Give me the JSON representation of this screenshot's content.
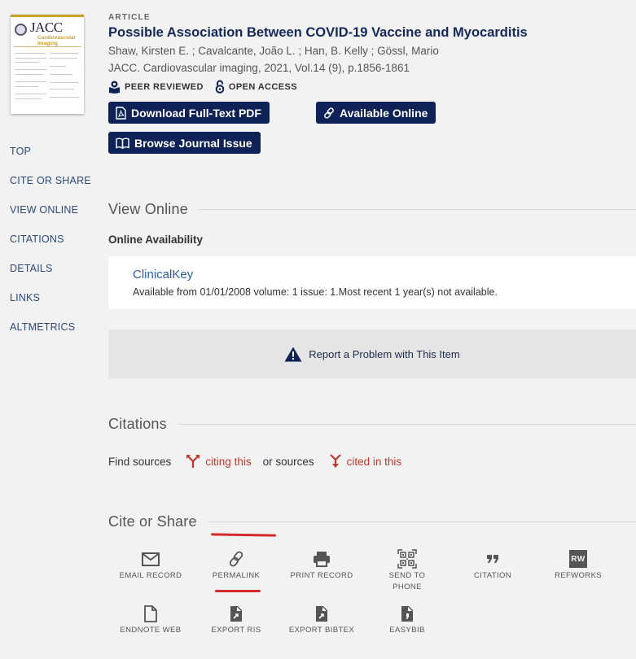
{
  "thumbnail": {
    "journal": "JACC",
    "subtitle_line1": "Cardiovascular",
    "subtitle_line2": "Imaging"
  },
  "sidebar": {
    "items": [
      {
        "label": "TOP"
      },
      {
        "label": "CITE OR SHARE"
      },
      {
        "label": "VIEW ONLINE"
      },
      {
        "label": "CITATIONS"
      },
      {
        "label": "DETAILS"
      },
      {
        "label": "LINKS"
      },
      {
        "label": "ALTMETRICS"
      }
    ]
  },
  "record": {
    "type": "ARTICLE",
    "title": "Possible Association Between COVID-19 Vaccine and Myocarditis",
    "authors": "Shaw, Kirsten E. ; Cavalcante, João L. ; Han, B. Kelly ; Gössl, Mario",
    "source": "JACC. Cardiovascular imaging, 2021, Vol.14 (9), p.1856-1861",
    "badges": [
      {
        "icon": "peer-reviewed-icon",
        "label": "PEER REVIEWED"
      },
      {
        "icon": "open-access-icon",
        "label": "OPEN ACCESS"
      }
    ]
  },
  "buttons": {
    "download_pdf": "Download Full-Text PDF",
    "available_online": "Available Online",
    "browse_issue": "Browse Journal Issue"
  },
  "view_online": {
    "heading": "View Online",
    "subheading": "Online Availability",
    "provider": "ClinicalKey",
    "coverage": "Available from 01/01/2008 volume: 1 issue: 1.Most recent 1 year(s) not available.",
    "report_label": "Report a Problem with This Item"
  },
  "citations": {
    "heading": "Citations",
    "find_sources": "Find sources",
    "citing_this": "citing this",
    "or_sources": "or sources",
    "cited_in_this": "cited in this"
  },
  "cite_share": {
    "heading": "Cite or Share",
    "actions": [
      {
        "icon": "email-icon",
        "label": "EMAIL RECORD"
      },
      {
        "icon": "link-icon",
        "label": "PERMALINK"
      },
      {
        "icon": "printer-icon",
        "label": "PRINT RECORD"
      },
      {
        "icon": "qr-code-icon",
        "label": "SEND TO PHONE"
      },
      {
        "icon": "quote-icon",
        "label": "CITATION"
      },
      {
        "icon": "refworks-icon",
        "label": "REFWORKS",
        "glyph": "RW"
      },
      {
        "icon": "document-icon",
        "label": "ENDNOTE WEB"
      },
      {
        "icon": "export-file-icon",
        "label": "EXPORT RIS"
      },
      {
        "icon": "export-file-icon",
        "label": "EXPORT BIBTEX"
      },
      {
        "icon": "easybib-icon",
        "label": "EASYBIB"
      }
    ]
  },
  "colors": {
    "primary_navy": "#0e2257",
    "title_navy": "#14285c",
    "link_blue": "#2a5ea8",
    "citation_red": "#c0392b",
    "annotation_red": "#d42a2a",
    "background": "#f2f2f2"
  }
}
